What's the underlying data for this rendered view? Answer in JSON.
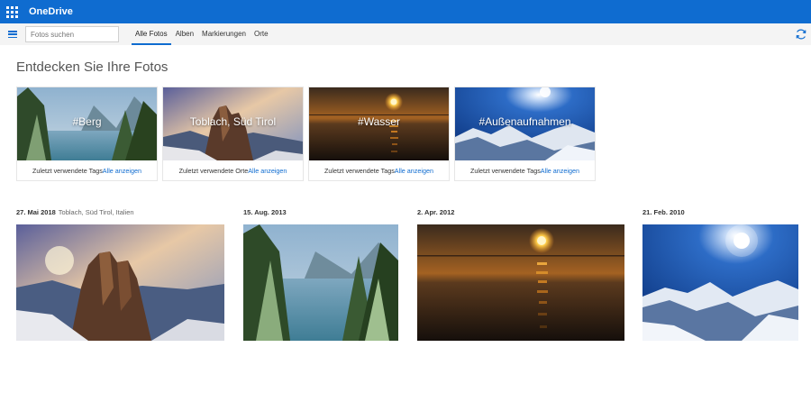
{
  "app": {
    "title": "OneDrive",
    "launcher_icon": "waffle-icon"
  },
  "commandbar": {
    "menu_icon": "hamburger-icon",
    "search_placeholder": "Fotos suchen",
    "tabs": [
      {
        "label": "Alle Fotos",
        "active": true
      },
      {
        "label": "Alben",
        "active": false
      },
      {
        "label": "Markierungen",
        "active": false
      },
      {
        "label": "Orte",
        "active": false
      }
    ],
    "refresh_icon": "refresh-icon"
  },
  "page": {
    "heading": "Entdecken Sie Ihre Fotos"
  },
  "discover_cards": [
    {
      "tag": "#Berg",
      "caption": "Zuletzt verwendete Tags",
      "link": "Alle anzeigen"
    },
    {
      "tag": "Toblach, Süd Tirol",
      "caption": "Zuletzt verwendete Orte",
      "link": "Alle anzeigen"
    },
    {
      "tag": "#Wasser",
      "caption": "Zuletzt verwendete Tags",
      "link": "Alle anzeigen"
    },
    {
      "tag": "#Außenaufnahmen",
      "caption": "Zuletzt verwendete Tags",
      "link": "Alle anzeigen"
    }
  ],
  "timeline": [
    {
      "date": "27. Mai 2018",
      "location": "Toblach, Süd Tirol, Italien"
    },
    {
      "date": "15. Aug. 2013",
      "location": ""
    },
    {
      "date": "2. Apr. 2012",
      "location": ""
    },
    {
      "date": "21. Feb. 2010",
      "location": ""
    }
  ],
  "colors": {
    "accent": "#0f6cd0",
    "appbar": "#0f6cd0",
    "commandbar": "#f4f4f4"
  }
}
